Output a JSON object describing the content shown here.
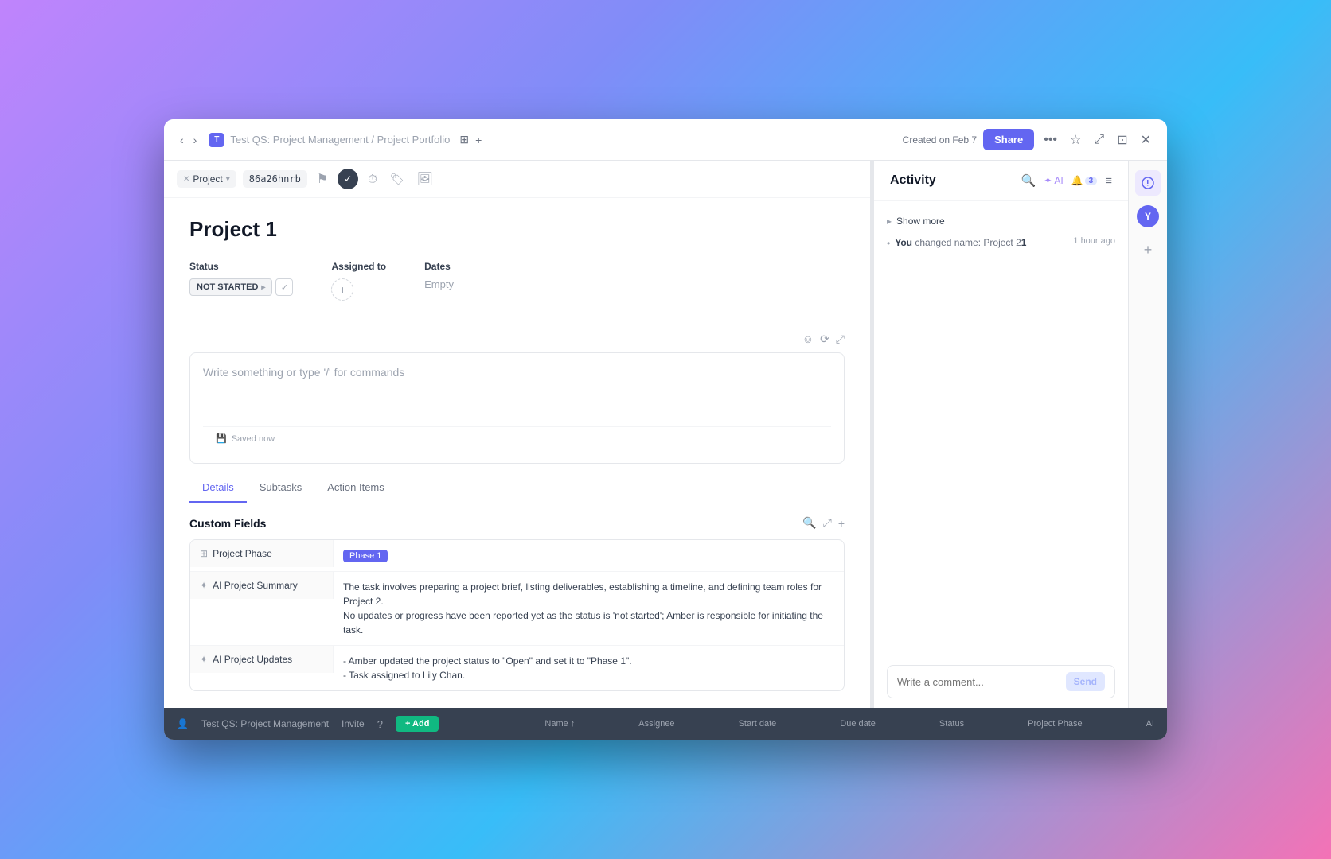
{
  "window": {
    "title": "Test QS: Project Management / Project Portfolio",
    "favicon_label": "T",
    "created_on": "Created on Feb 7",
    "share_label": "Share"
  },
  "toolbar": {
    "project_tag": "Project",
    "id_code": "86a26hnrb"
  },
  "task": {
    "title": "Project 1",
    "status_label": "Status",
    "status_value": "NOT STARTED",
    "assigned_to_label": "Assigned to",
    "dates_label": "Dates",
    "dates_value": "Empty",
    "editor_placeholder": "Write something or type '/' for commands",
    "saved_label": "Saved now"
  },
  "tabs": {
    "details": "Details",
    "subtasks": "Subtasks",
    "action_items": "Action Items"
  },
  "custom_fields": {
    "title": "Custom Fields",
    "rows": [
      {
        "key": "Project Phase",
        "value": "Phase 1",
        "type": "badge"
      },
      {
        "key": "AI Project Summary",
        "value": "The task involves preparing a project brief, listing deliverables, establishing a timeline, and defining team roles for Project 2.\nNo updates or progress have been reported yet as the status is 'not started'; Amber is responsible for initiating the task."
      },
      {
        "key": "AI Project Updates",
        "value": "- Amber updated the project status to \"Open\" and set it to \"Phase 1\".\n- Task assigned to Lily Chan."
      }
    ]
  },
  "activity": {
    "title": "Activity",
    "ai_label": "AI",
    "notif_count": "3",
    "show_more": "Show more",
    "item": {
      "user": "You",
      "action": "changed name: Project 2",
      "suffix": "1",
      "time": "1 hour ago"
    },
    "comment_placeholder": "Write a comment...",
    "send_label": "Send"
  },
  "bottom_bar": {
    "workspace": "Test QS: Project Management",
    "invite_label": "Invite",
    "columns": [
      "Name",
      "Assignee",
      "Start date",
      "Due date",
      "Status",
      "Project Phase",
      "AI"
    ]
  }
}
